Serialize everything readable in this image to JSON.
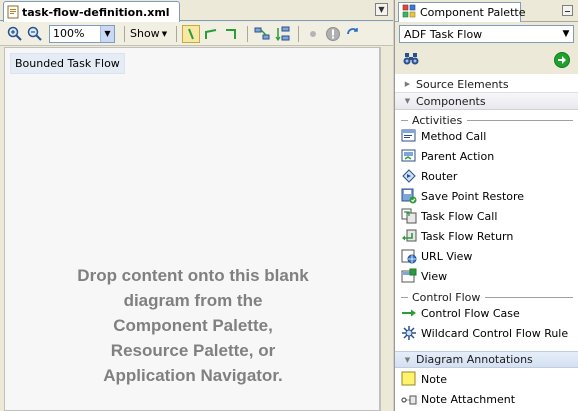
{
  "editor": {
    "tab_title": "task-flow-definition.xml",
    "tab_icon": "xml-file-icon",
    "tab_menu_icon": "chevron-down-icon",
    "toolbar": {
      "zoom_in_icon": "zoom-in-icon",
      "zoom_out_icon": "zoom-out-icon",
      "zoom_value": "100%",
      "show_label": "Show",
      "tools": [
        "select-icon",
        "straight-line-icon",
        "elbow-line-icon",
        "layout-horizontal-icon",
        "layout-vertical-icon",
        "breakpoint-icon",
        "disabled-breakpoint-icon",
        "refresh-icon"
      ]
    },
    "diagram_label": "Bounded Task Flow",
    "drop_hint": [
      "Drop content onto this blank",
      "diagram from the",
      "Component Palette,",
      "Resource Palette, or",
      "Application Navigator."
    ]
  },
  "palette": {
    "title": "Component Palette",
    "selected_library": "ADF Task Flow",
    "search_icon": "binoculars-icon",
    "go_icon": "go-arrow-icon",
    "sections": {
      "source": "Source Elements",
      "components": "Components",
      "annotations": "Diagram Annotations"
    },
    "activities_label": "Activities",
    "activities": [
      {
        "label": "Method Call",
        "icon": "method-call-icon"
      },
      {
        "label": "Parent Action",
        "icon": "parent-action-icon"
      },
      {
        "label": "Router",
        "icon": "router-icon"
      },
      {
        "label": "Save Point Restore",
        "icon": "save-point-restore-icon"
      },
      {
        "label": "Task Flow Call",
        "icon": "task-flow-call-icon"
      },
      {
        "label": "Task Flow Return",
        "icon": "task-flow-return-icon"
      },
      {
        "label": "URL View",
        "icon": "url-view-icon"
      },
      {
        "label": "View",
        "icon": "view-icon"
      }
    ],
    "control_flow_label": "Control Flow",
    "control_flow": [
      {
        "label": "Control Flow Case",
        "icon": "control-flow-case-icon"
      },
      {
        "label": "Wildcard Control Flow Rule",
        "icon": "wildcard-rule-icon"
      }
    ],
    "annotations": [
      {
        "label": "Note",
        "icon": "note-icon"
      },
      {
        "label": "Note Attachment",
        "icon": "note-attachment-icon"
      }
    ],
    "colors": {
      "accent_green": "#1fa12e",
      "selection_blue": "#d4e0f2",
      "hint_gray": "#808080"
    }
  }
}
